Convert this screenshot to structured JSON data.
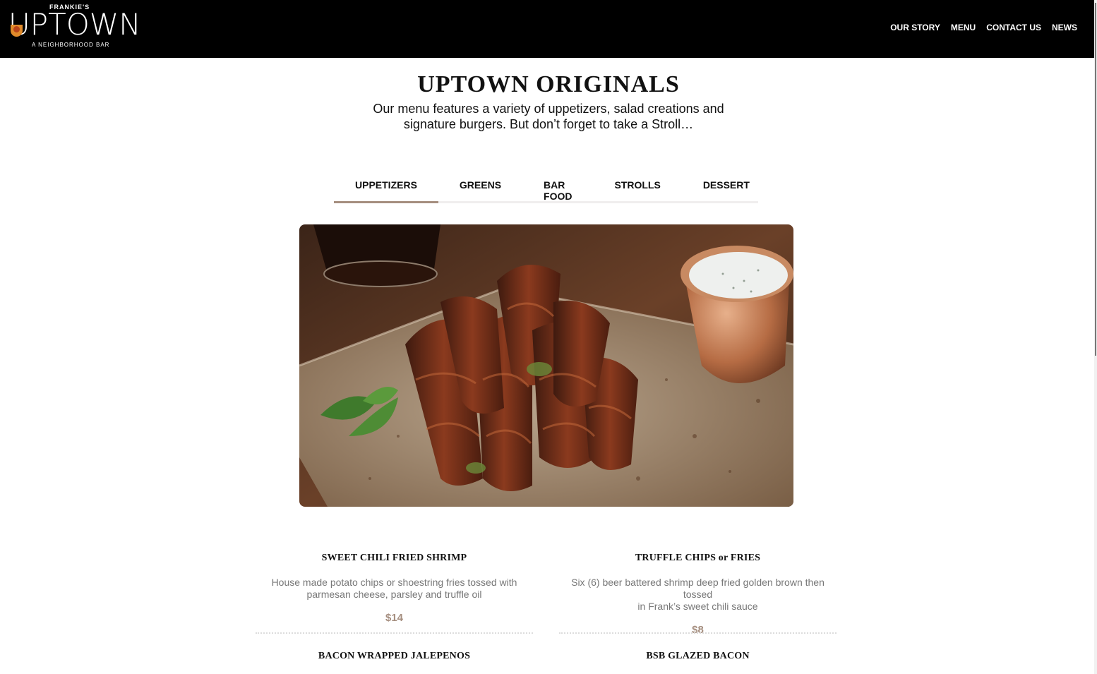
{
  "brand": {
    "pre": "FRANKIE'S",
    "name": "UPTOWN",
    "tagline": "A NEIGHBORHOOD BAR"
  },
  "nav": {
    "items": [
      "OUR STORY",
      "MENU",
      "CONTACT US",
      "NEWS"
    ]
  },
  "hero": {
    "title": "UPTOWN ORIGINALS",
    "intro_line1": "Our menu features a variety of uppetizers, salad creations and",
    "intro_line2": "signature burgers. But don’t forget to take a Stroll…"
  },
  "tabs": {
    "active": "UPPETIZERS",
    "items": [
      "UPPETIZERS",
      "GREENS",
      "BAR FOOD",
      "STROLLS",
      "DESSERT"
    ]
  },
  "photo": {
    "subject": "bacon wrapped jalapenos with dipping sauce"
  },
  "menu_items": [
    {
      "name": "SWEET CHILI FRIED SHRIMP",
      "desc1": "House made potato chips or shoestring fries tossed with",
      "desc2": "parmesan cheese, parsley and truffle oil",
      "price": "$14"
    },
    {
      "name": "TRUFFLE CHIPS or FRIES",
      "desc1": "Six (6) beer battered shrimp deep fried golden brown then tossed",
      "desc2": "in Frank’s sweet chili sauce",
      "price": "$8"
    },
    {
      "name": "BACON WRAPPED JALEPENOS"
    },
    {
      "name": "BSB GLAZED BACON"
    }
  ],
  "colors": {
    "accent": "#a58e7f",
    "header_bg": "#000000",
    "muted_text": "#777777"
  }
}
